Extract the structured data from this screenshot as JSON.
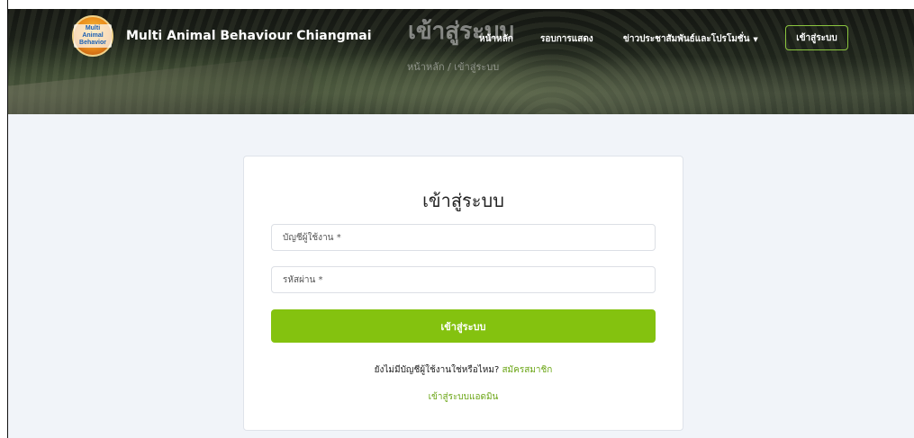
{
  "brand": {
    "name": "Multi Animal Behaviour Chiangmai",
    "logo_text": "Multi Animal Behavior"
  },
  "hero": {
    "title": "เข้าสู่ระบบ",
    "breadcrumb": "หน้าหลัก / เข้าสู่ระบบ"
  },
  "nav": {
    "home": "หน้าหลัก",
    "shows": "รอบการแสดง",
    "news": "ข่าวประชาสัมพันธ์และโปรโมชั่น",
    "login": "เข้าสู่ระบบ"
  },
  "form": {
    "title": "เข้าสู่ระบบ",
    "username_placeholder": "บัญชีผู้ใช้งาน *",
    "password_placeholder": "รหัสผ่าน *",
    "submit_label": "เข้าสู่ระบบ",
    "no_account_text": "ยังไม่มีบัญชีผู้ใช้งานใช่หรือไหม?",
    "register_link": "สมัครสมาชิก",
    "admin_login_link": "เข้าสู่ระบบแอดมิน"
  },
  "colors": {
    "accent_green": "#84c20f",
    "link_green": "#6aa514",
    "page_background": "#f1f4f9"
  }
}
